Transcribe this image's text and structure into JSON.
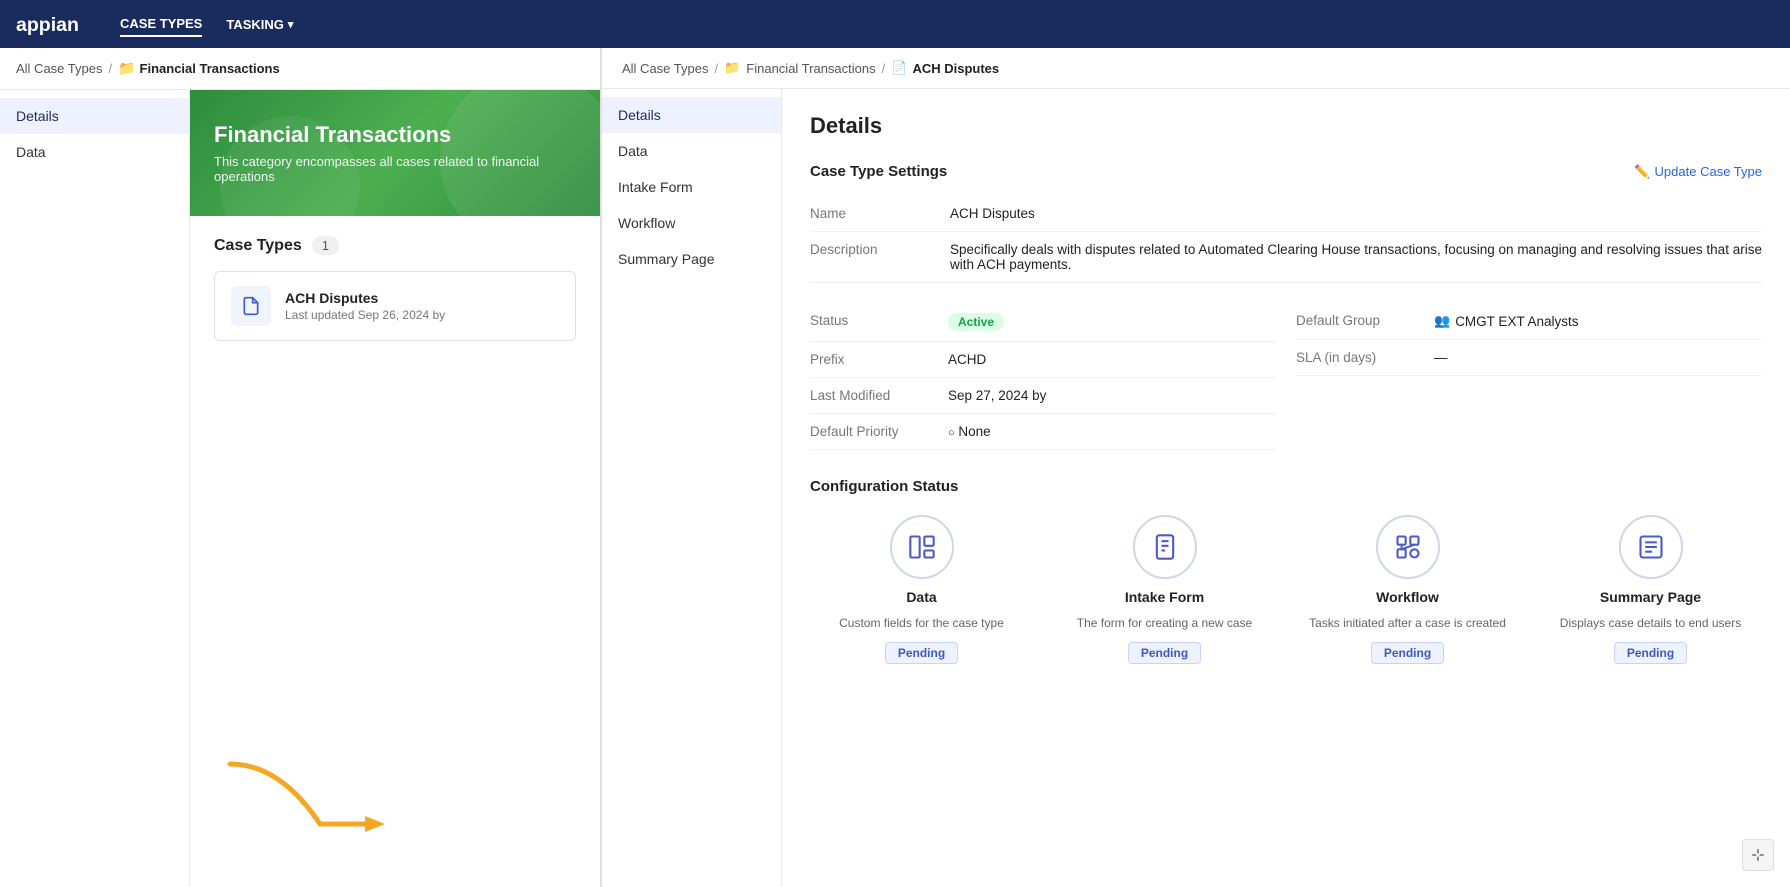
{
  "nav": {
    "logo_text": "appian",
    "items": [
      {
        "label": "CASE TYPES",
        "active": true
      },
      {
        "label": "TASKING",
        "active": false,
        "has_dropdown": true
      }
    ]
  },
  "left_panel": {
    "breadcrumb": {
      "all_case_types": "All Case Types",
      "separator": "/",
      "current_icon": "📁",
      "current": "Financial Transactions"
    },
    "sidebar_items": [
      {
        "label": "Details",
        "active": true
      },
      {
        "label": "Data",
        "active": false
      }
    ],
    "banner": {
      "title": "Financial Transactions",
      "description": "This category encompasses all cases related to financial operations"
    },
    "case_types_section": {
      "title": "Case Types",
      "count": "1",
      "items": [
        {
          "name": "ACH Disputes",
          "meta": "Last updated Sep 26, 2024 by"
        }
      ]
    }
  },
  "right_panel": {
    "breadcrumb": {
      "all_case_types": "All Case Types",
      "sep1": "/",
      "folder_icon": "📁",
      "financial_transactions": "Financial Transactions",
      "sep2": "/",
      "doc_icon": "📄",
      "current": "ACH Disputes"
    },
    "sidebar_items": [
      {
        "label": "Details",
        "active": true
      },
      {
        "label": "Data",
        "active": false
      },
      {
        "label": "Intake Form",
        "active": false
      },
      {
        "label": "Workflow",
        "active": false
      },
      {
        "label": "Summary Page",
        "active": false
      }
    ],
    "content": {
      "heading": "Details",
      "settings_section_title": "Case Type Settings",
      "update_link": "Update Case Type",
      "fields": {
        "name_label": "Name",
        "name_value": "ACH Disputes",
        "description_label": "Description",
        "description_value": "Specifically deals with disputes related to Automated Clearing House transactions, focusing on managing and resolving issues that arise with ACH payments.",
        "status_label": "Status",
        "status_value": "Active",
        "default_group_label": "Default Group",
        "default_group_value": "CMGT EXT Analysts",
        "prefix_label": "Prefix",
        "prefix_value": "ACHD",
        "sla_label": "SLA (in days)",
        "sla_value": "—",
        "last_modified_label": "Last Modified",
        "last_modified_value": "Sep 27, 2024 by",
        "default_priority_label": "Default Priority",
        "default_priority_value": "None"
      },
      "config_section": {
        "title": "Configuration Status",
        "cards": [
          {
            "title": "Data",
            "description": "Custom fields for the case type",
            "status": "Pending",
            "icon": "data-icon"
          },
          {
            "title": "Intake Form",
            "description": "The form for creating a new case",
            "status": "Pending",
            "icon": "form-icon"
          },
          {
            "title": "Workflow",
            "description": "Tasks initiated after a case is created",
            "status": "Pending",
            "icon": "workflow-icon"
          },
          {
            "title": "Summary Page",
            "description": "Displays case details to end users",
            "status": "Pending",
            "icon": "summary-icon"
          }
        ]
      }
    }
  }
}
